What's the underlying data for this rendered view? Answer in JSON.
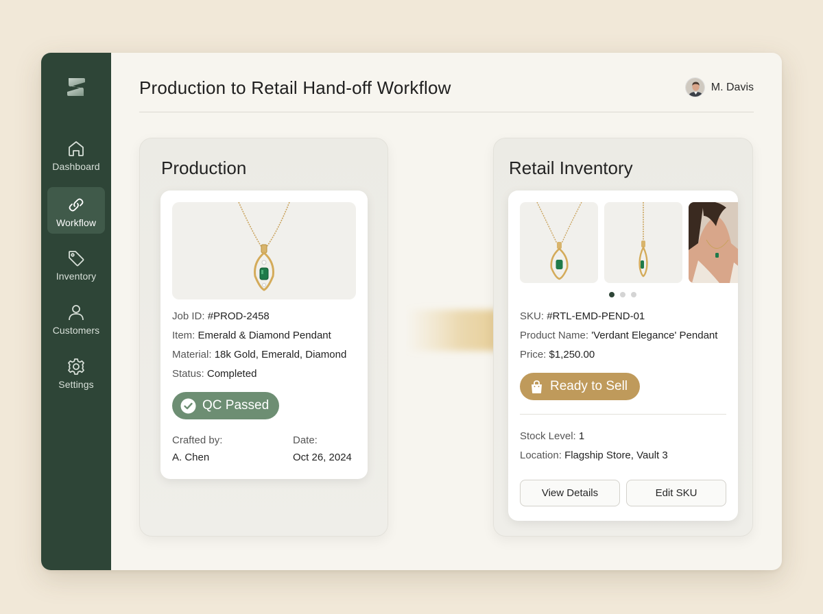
{
  "app": {
    "page_title": "Production to Retail Hand-off Workflow",
    "user_name": "M. Davis"
  },
  "sidebar": {
    "items": [
      {
        "label": "Dashboard",
        "icon": "home-icon"
      },
      {
        "label": "Workflow",
        "icon": "link-icon",
        "active": true
      },
      {
        "label": "Inventory",
        "icon": "tag-icon"
      },
      {
        "label": "Customers",
        "icon": "user-icon"
      },
      {
        "label": "Settings",
        "icon": "gear-icon"
      }
    ]
  },
  "production": {
    "title": "Production",
    "job_id_label": "Job ID:",
    "job_id": "#PROD-2458",
    "item_label": "Item:",
    "item": "Emerald & Diamond Pendant",
    "material_label": "Material:",
    "material": "18k Gold, Emerald, Diamond",
    "status_label": "Status:",
    "status": "Completed",
    "qc_badge": "QC Passed",
    "crafted_by_label": "Crafted by:",
    "crafted_by": "A. Chen",
    "date_label": "Date:",
    "date": "Oct 26, 2024"
  },
  "retail": {
    "title": "Retail Inventory",
    "sku_label": "SKU:",
    "sku": "#RTL-EMD-PEND-01",
    "product_name_label": "Product Name:",
    "product_name": "'Verdant Elegance' Pendant",
    "price_label": "Price:",
    "price": "$1,250.00",
    "sell_badge": "Ready to Sell",
    "stock_label": "Stock Level:",
    "stock": "1",
    "location_label": "Location:",
    "location": "Flagship Store, Vault 3",
    "view_details_button": "View Details",
    "edit_sku_button": "Edit SKU",
    "carousel_active_index": 0,
    "carousel_count": 3
  },
  "colors": {
    "sidebar": "#2e4537",
    "qc_badge": "#6d8e73",
    "sell_badge": "#bf9a5b",
    "arrow": "#b89a5e",
    "background": "#f1e8d8"
  }
}
